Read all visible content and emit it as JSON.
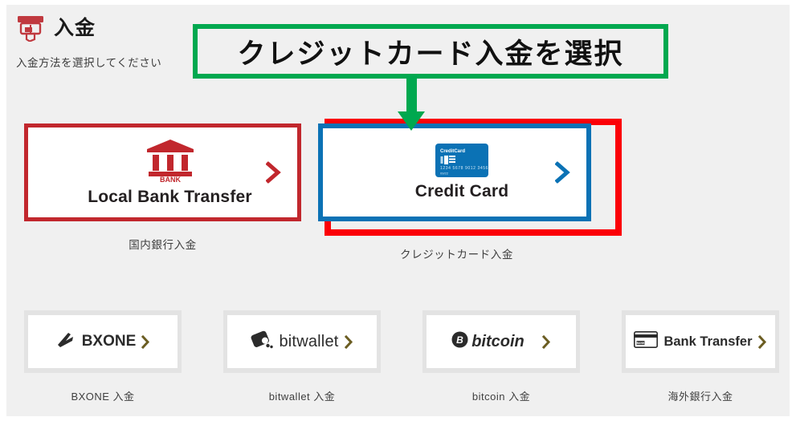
{
  "header": {
    "icon": "atm-deposit-icon",
    "title": "入金",
    "subtitle": "入金方法を選択してください"
  },
  "annotation": {
    "text": "クレジットカード入金を選択",
    "border_color": "#00a84f",
    "arrow_color": "#00a84f",
    "highlight_box_color": "#fb0007"
  },
  "primary_methods": [
    {
      "icon": "bank-building-icon",
      "icon_label": "BANK",
      "label": "Local Bank Transfer",
      "caption": "国内銀行入金",
      "chevron": "chevron-right-icon",
      "accent": "#c1272d"
    },
    {
      "icon": "credit-card-icon",
      "card_brand_text": "CreditCard",
      "card_number": "1234 5678 9012 3456",
      "card_expiry": "09/22",
      "label": "Credit Card",
      "caption": "クレジットカード入金",
      "chevron": "chevron-right-icon",
      "accent": "#0b72b5"
    }
  ],
  "secondary_methods": [
    {
      "logo": "bxone-logo-icon",
      "name": "BXONE",
      "caption": "BXONE 入金",
      "chevron": "chevron-right-icon"
    },
    {
      "logo": "bitwallet-logo-icon",
      "name": "bitwallet",
      "caption": "bitwallet 入金",
      "chevron": "chevron-right-icon"
    },
    {
      "logo": "bitcoin-logo-icon",
      "name": "bitcoin",
      "caption": "bitcoin 入金",
      "chevron": "chevron-right-icon"
    },
    {
      "logo": "bank-card-icon",
      "name": "Bank Transfer",
      "caption": "海外銀行入金",
      "chevron": "chevron-right-icon"
    }
  ]
}
